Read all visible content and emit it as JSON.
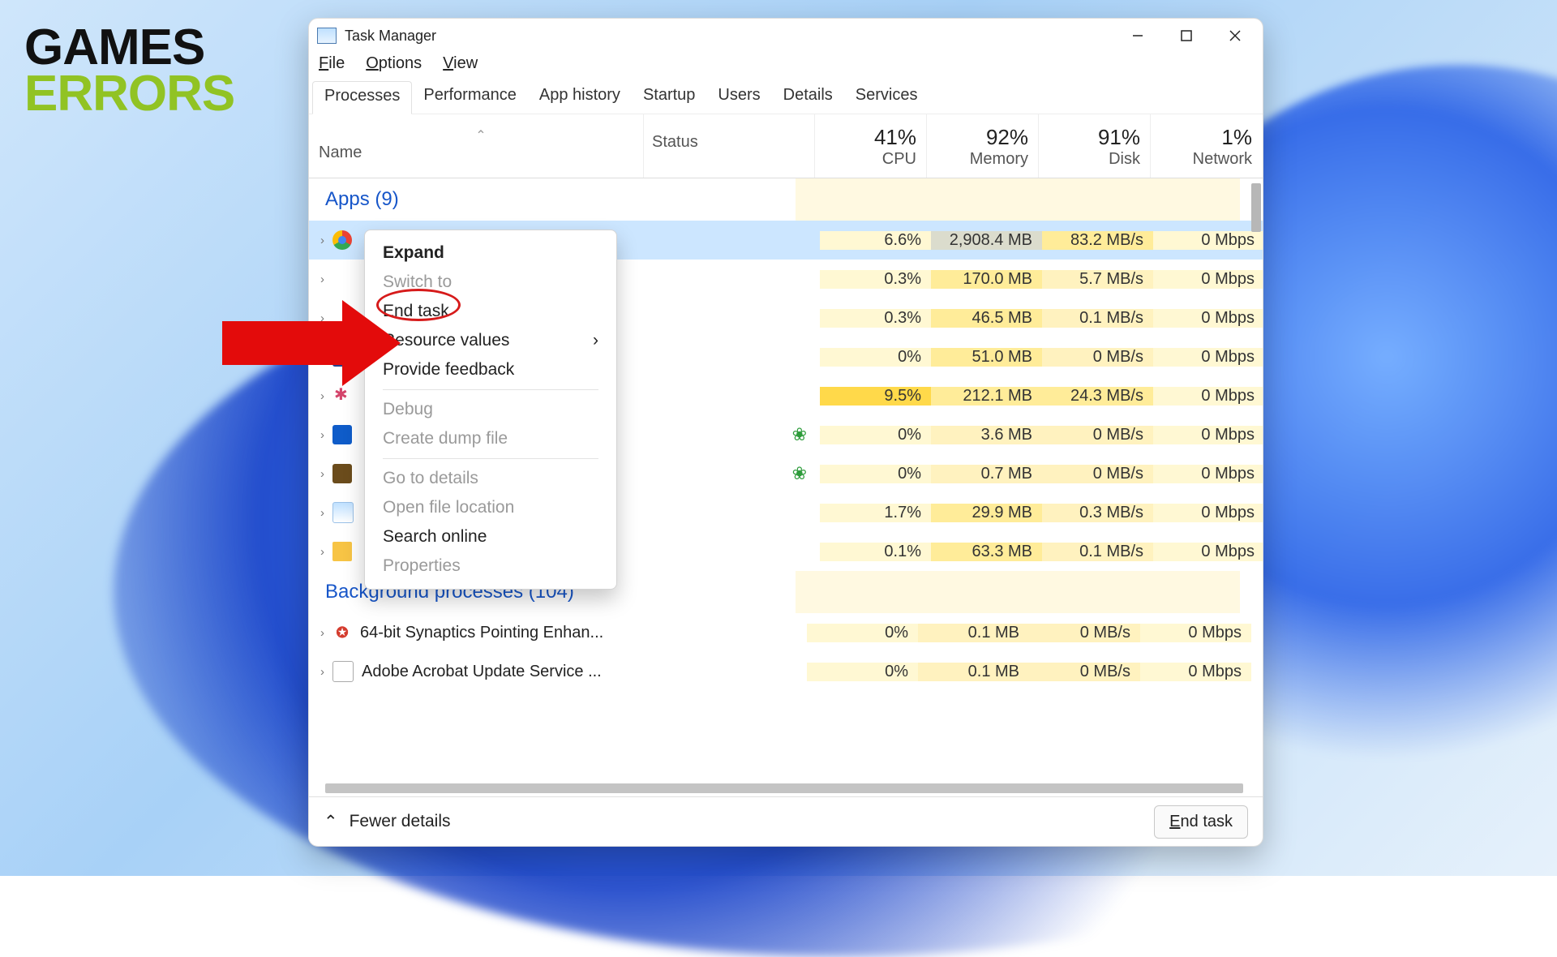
{
  "brand": {
    "line1": "GAMES",
    "line2": "ERRORS"
  },
  "window": {
    "title": "Task Manager",
    "menus": [
      "File",
      "Options",
      "View"
    ],
    "tabs": [
      "Processes",
      "Performance",
      "App history",
      "Startup",
      "Users",
      "Details",
      "Services"
    ],
    "active_tab": "Processes",
    "minimize": "−",
    "maximize": "▢",
    "close": "✕"
  },
  "columns": {
    "name": "Name",
    "status": "Status",
    "cpu": {
      "pct": "41%",
      "label": "CPU"
    },
    "mem": {
      "pct": "92%",
      "label": "Memory"
    },
    "disk": {
      "pct": "91%",
      "label": "Disk"
    },
    "net": {
      "pct": "1%",
      "label": "Network"
    }
  },
  "groups": {
    "apps": "Apps (9)",
    "bg": "Background processes (104)"
  },
  "rows": [
    {
      "icon": "ic-chrome",
      "sel": true,
      "leaf": false,
      "cpu": "6.6%",
      "mem": "2,908.4 MB",
      "disk": "83.2 MB/s",
      "net": "0 Mbps",
      "cpu_s": "s5",
      "mem_s": "sD",
      "disk_s": "s2",
      "net_s": "s5"
    },
    {
      "icon": "",
      "sel": false,
      "leaf": false,
      "cpu": "0.3%",
      "mem": "170.0 MB",
      "disk": "5.7 MB/s",
      "net": "0 Mbps",
      "cpu_s": "s5",
      "mem_s": "s2",
      "disk_s": "s1",
      "net_s": "s5"
    },
    {
      "icon": "",
      "sel": false,
      "leaf": false,
      "cpu": "0.3%",
      "mem": "46.5 MB",
      "disk": "0.1 MB/s",
      "net": "0 Mbps",
      "cpu_s": "s5",
      "mem_s": "s2",
      "disk_s": "s1",
      "net_s": "s5"
    },
    {
      "icon": "ic-box",
      "sel": false,
      "leaf": false,
      "cpu": "0%",
      "mem": "51.0 MB",
      "disk": "0 MB/s",
      "net": "0 Mbps",
      "cpu_s": "s5",
      "mem_s": "s2",
      "disk_s": "s1",
      "net_s": "s5"
    },
    {
      "icon": "ic-slack",
      "sel": false,
      "leaf": false,
      "cpu": "9.5%",
      "mem": "212.1 MB",
      "disk": "24.3 MB/s",
      "net": "0 Mbps",
      "cpu_s": "s4",
      "mem_s": "s2",
      "disk_s": "s2",
      "net_s": "s5"
    },
    {
      "icon": "ic-blue",
      "sel": false,
      "leaf": true,
      "cpu": "0%",
      "mem": "3.6 MB",
      "disk": "0 MB/s",
      "net": "0 Mbps",
      "cpu_s": "s5",
      "mem_s": "s1",
      "disk_s": "s1",
      "net_s": "s5"
    },
    {
      "icon": "ic-brown",
      "sel": false,
      "leaf": true,
      "cpu": "0%",
      "mem": "0.7 MB",
      "disk": "0 MB/s",
      "net": "0 Mbps",
      "cpu_s": "s5",
      "mem_s": "s1",
      "disk_s": "s1",
      "net_s": "s5"
    },
    {
      "icon": "ic-pic",
      "sel": false,
      "leaf": false,
      "cpu": "1.7%",
      "mem": "29.9 MB",
      "disk": "0.3 MB/s",
      "net": "0 Mbps",
      "cpu_s": "s5",
      "mem_s": "s2",
      "disk_s": "s1",
      "net_s": "s5"
    },
    {
      "icon": "ic-folder",
      "sel": false,
      "leaf": false,
      "cpu": "0.1%",
      "mem": "63.3 MB",
      "disk": "0.1 MB/s",
      "net": "0 Mbps",
      "cpu_s": "s5",
      "mem_s": "s2",
      "disk_s": "s1",
      "net_s": "s5"
    }
  ],
  "bg_rows": [
    {
      "icon": "ic-syn",
      "glyph": "✪",
      "name": "64-bit Synaptics Pointing Enhan...",
      "cpu": "0%",
      "mem": "0.1 MB",
      "disk": "0 MB/s",
      "net": "0 Mbps"
    },
    {
      "icon": "ic-adobe",
      "glyph": "",
      "name": "Adobe Acrobat Update Service ...",
      "cpu": "0%",
      "mem": "0.1 MB",
      "disk": "0 MB/s",
      "net": "0 Mbps"
    }
  ],
  "context_menu": {
    "items": [
      {
        "label": "Expand",
        "bold": true,
        "enabled": true,
        "arrow": false
      },
      {
        "label": "Switch to",
        "bold": false,
        "enabled": false,
        "arrow": false
      },
      {
        "label": "End task",
        "bold": false,
        "enabled": true,
        "arrow": false,
        "circled": true
      },
      {
        "label": "Resource values",
        "bold": false,
        "enabled": true,
        "arrow": true
      },
      {
        "label": "Provide feedback",
        "bold": false,
        "enabled": true,
        "arrow": false
      },
      {
        "sep": true
      },
      {
        "label": "Debug",
        "bold": false,
        "enabled": false,
        "arrow": false
      },
      {
        "label": "Create dump file",
        "bold": false,
        "enabled": false,
        "arrow": false
      },
      {
        "sep": true
      },
      {
        "label": "Go to details",
        "bold": false,
        "enabled": false,
        "arrow": false
      },
      {
        "label": "Open file location",
        "bold": false,
        "enabled": false,
        "arrow": false
      },
      {
        "label": "Search online",
        "bold": false,
        "enabled": true,
        "arrow": false
      },
      {
        "label": "Properties",
        "bold": false,
        "enabled": false,
        "arrow": false
      }
    ]
  },
  "footer": {
    "fewer": "Fewer details",
    "end_task": "End task"
  }
}
